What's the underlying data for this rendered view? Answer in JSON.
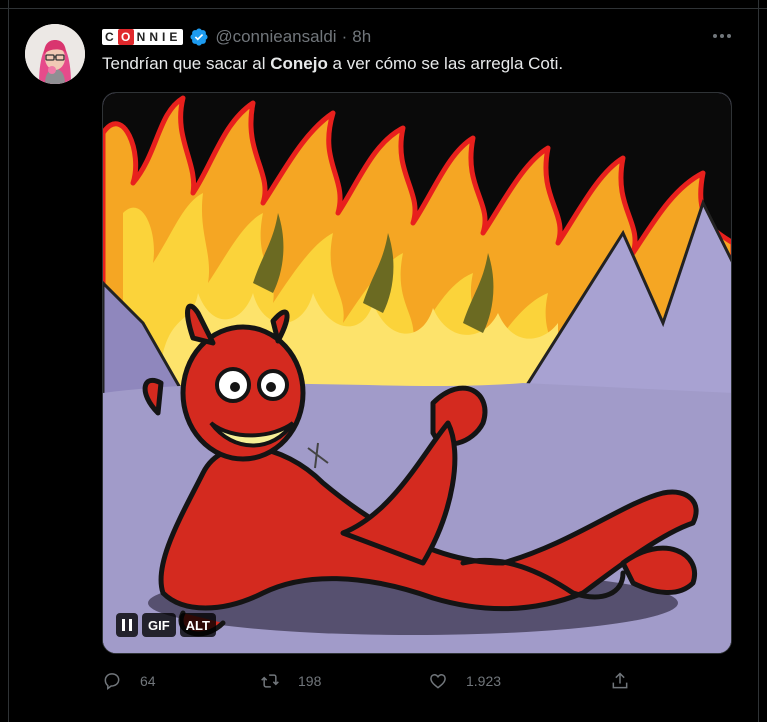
{
  "tweet": {
    "display_name": "CONNIE",
    "handle": "@connieansaldi",
    "separator": "·",
    "time": "8h",
    "text_before": "Tendrían que sacar al ",
    "text_bold": "Conejo",
    "text_after": " a ver cómo se las arregla Coti.",
    "media_badges": {
      "pause": "❚❚",
      "gif": "GIF",
      "alt": "ALT"
    },
    "stats": {
      "replies": "64",
      "retweets": "198",
      "likes": "1.923"
    }
  },
  "icons": {
    "verified": "verified-badge-icon",
    "more": "more-dots-icon",
    "reply": "reply-icon",
    "retweet": "retweet-icon",
    "like": "heart-icon",
    "share": "share-icon"
  },
  "colors": {
    "background": "#000000",
    "text": "#e7e9ea",
    "muted": "#71767b",
    "verified": "#1d9bf0",
    "accent": "#e0282c"
  }
}
